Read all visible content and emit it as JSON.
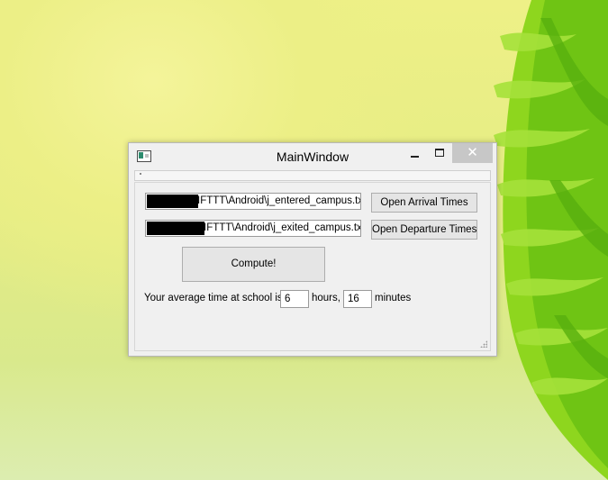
{
  "window": {
    "title": "MainWindow",
    "close_glyph": "✕"
  },
  "arrival": {
    "path_suffix": "IFTTT\\Android\\j_entered_campus.txt",
    "button_label": "Open Arrival Times"
  },
  "departure": {
    "path_suffix": "IFTTT\\Android\\j_exited_campus.txt",
    "button_label": "Open Departure Times"
  },
  "compute": {
    "button_label": "Compute!"
  },
  "result": {
    "prefix": "Your average time at school is",
    "hours_value": "6",
    "hours_label": "hours,",
    "minutes_value": "16",
    "minutes_label": "minutes"
  },
  "icons": {
    "app": "app-window-icon",
    "minimize": "minimize-icon",
    "maximize": "maximize-icon",
    "close": "close-icon",
    "grip": "size-grip-icon"
  },
  "colors": {
    "redaction": "#000000",
    "window_bg": "#f0f0f0",
    "button_bg": "#e5e5e5"
  }
}
